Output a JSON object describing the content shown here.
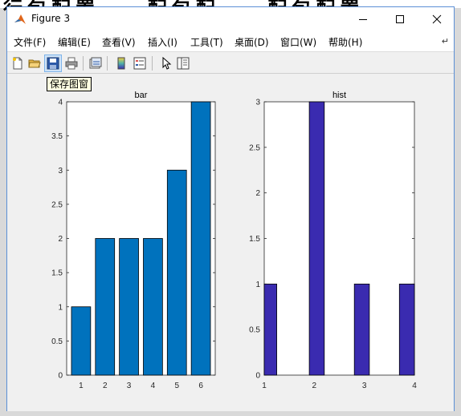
{
  "window": {
    "title": "Figure 3"
  },
  "controls": {
    "minimize": "minimize",
    "maximize": "maximize",
    "close": "close"
  },
  "menu": [
    {
      "label": "文件(F)"
    },
    {
      "label": "编辑(E)"
    },
    {
      "label": "查看(V)"
    },
    {
      "label": "插入(I)"
    },
    {
      "label": "工具(T)"
    },
    {
      "label": "桌面(D)"
    },
    {
      "label": "窗口(W)"
    },
    {
      "label": "帮助(H)"
    }
  ],
  "toolbar": [
    {
      "icon": "new-figure-icon"
    },
    {
      "icon": "open-folder-icon"
    },
    {
      "icon": "save-icon",
      "active": true
    },
    {
      "icon": "print-icon"
    },
    {
      "icon": "link-plot-icon"
    },
    {
      "icon": "colorbar-icon"
    },
    {
      "icon": "legend-icon"
    },
    {
      "icon": "pointer-icon"
    },
    {
      "icon": "property-editor-icon"
    }
  ],
  "tooltip": {
    "text": "保存图窗"
  },
  "chart_data": [
    {
      "type": "bar",
      "title": "bar",
      "categories": [
        "1",
        "2",
        "3",
        "4",
        "5",
        "6"
      ],
      "values": [
        1,
        2,
        2,
        2,
        3,
        4
      ],
      "ylim": [
        0,
        4
      ],
      "yticks": [
        "0",
        "0.5",
        "1",
        "1.5",
        "2",
        "2.5",
        "3",
        "3.5",
        "4"
      ],
      "bar_color": "#0072bd"
    },
    {
      "type": "bar",
      "title": "hist",
      "x": [
        1.1,
        2.05,
        2.95,
        3.85
      ],
      "values": [
        1,
        3,
        1,
        1
      ],
      "xlim": [
        1,
        4
      ],
      "ylim": [
        0,
        3
      ],
      "xticks": [
        "1",
        "2",
        "3",
        "4"
      ],
      "yticks": [
        "0",
        "0.5",
        "1",
        "1.5",
        "2",
        "2.5",
        "3"
      ],
      "bar_color": "#3a2bb0"
    }
  ]
}
